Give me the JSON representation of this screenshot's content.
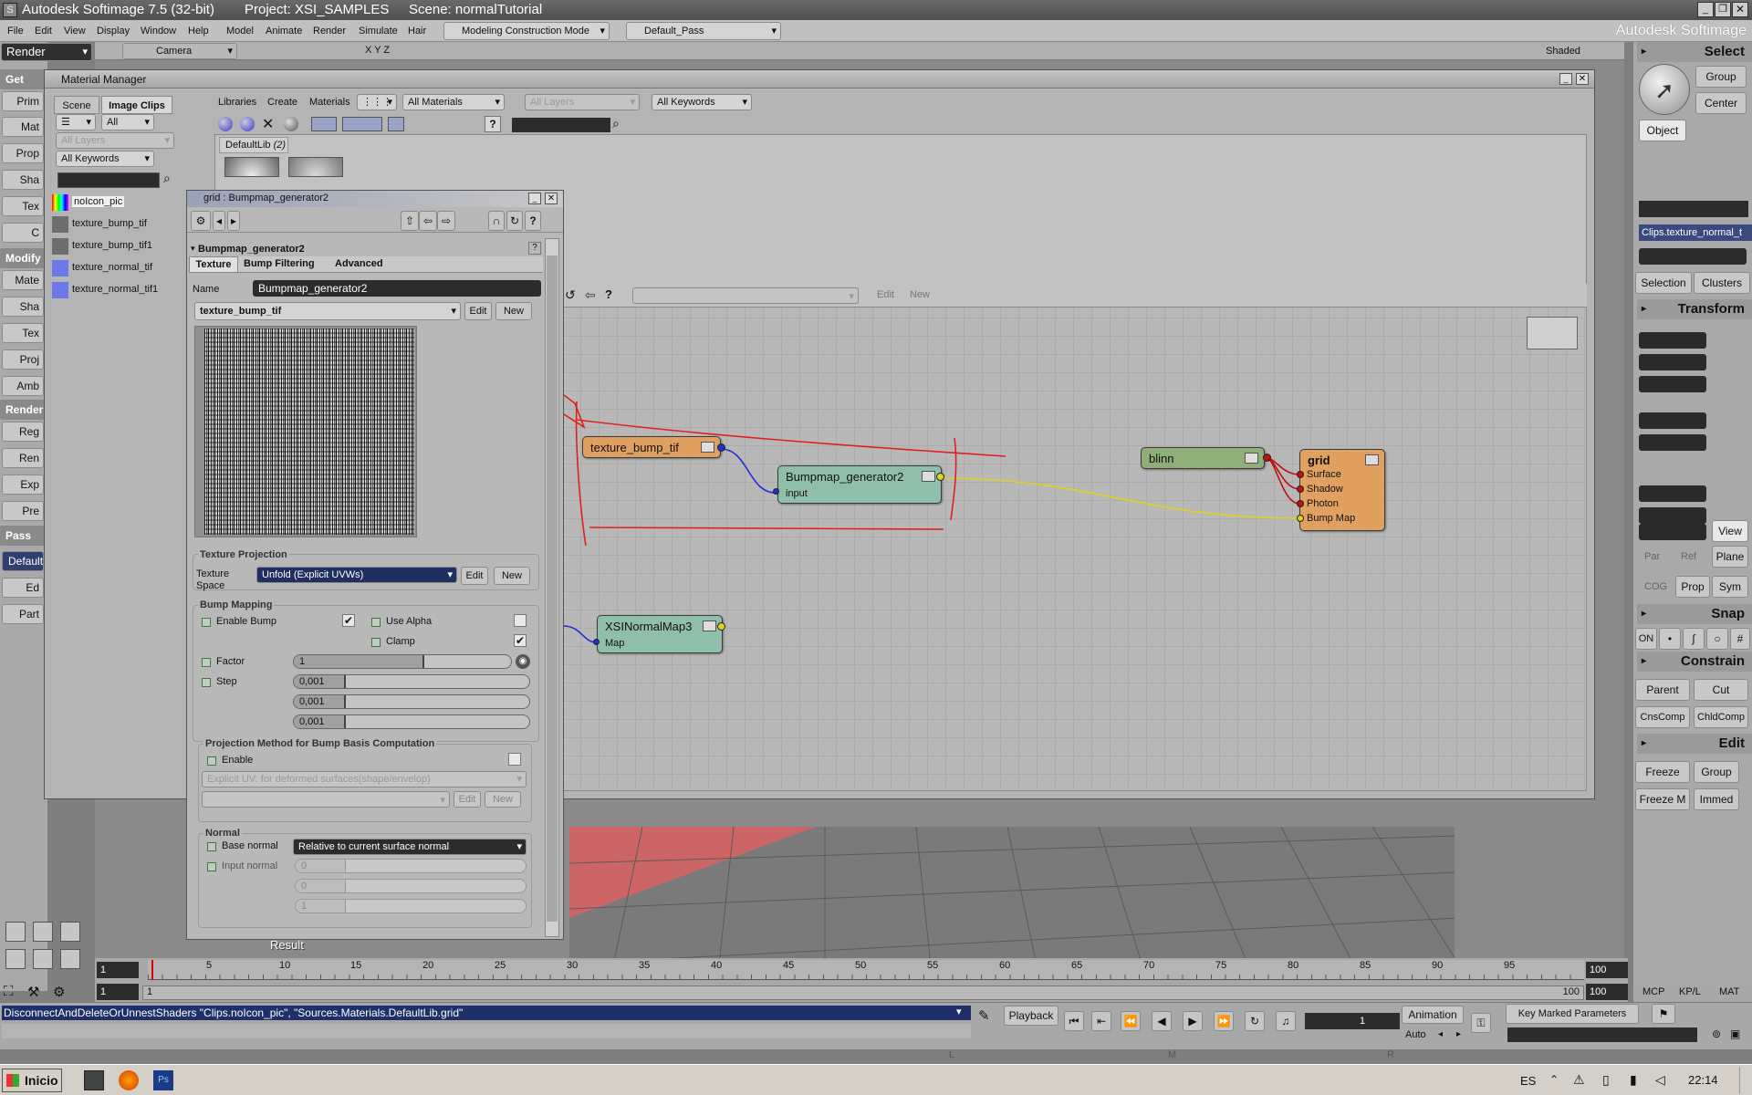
{
  "window": {
    "title": "Autodesk Softimage 7.5 (32-bit)",
    "project": "Project: XSI_SAMPLES",
    "scene": "Scene: normalTutorial",
    "brand": "Autodesk Softimage"
  },
  "menu": [
    "File",
    "Edit",
    "View",
    "Display",
    "Window",
    "Help",
    "Model",
    "Animate",
    "Render",
    "Simulate",
    "Hair"
  ],
  "mode_select": "Modeling Construction Mode",
  "pass_select": "Default_Pass",
  "left": {
    "module": "Render",
    "sections": {
      "get": "Get",
      "modify": "Modify",
      "render": "Render",
      "pass": "Pass"
    },
    "get_items": [
      "Prim",
      "Mat",
      "Prop",
      "Sha",
      "Tex",
      "C"
    ],
    "modify_items": [
      "Mate",
      "Sha",
      "Tex",
      "Proj",
      "Amb"
    ],
    "render_items": [
      "Reg",
      "Ren",
      "Exp",
      "Pre"
    ],
    "pass_items": [
      "Default",
      "Ed",
      "Part"
    ]
  },
  "viewport": {
    "camera": "Camera",
    "axes": "X Y Z",
    "shading": "Shaded",
    "label": "Result"
  },
  "material_manager": {
    "title": "Material Manager",
    "tabs": [
      "Scene",
      "Image Clips"
    ],
    "filter_all": "All",
    "layers": "All Layers",
    "keywords": "All Keywords",
    "clips": [
      "noIcon_pic",
      "texture_bump_tif",
      "texture_bump_tif1",
      "texture_normal_tif",
      "texture_normal_tif1"
    ],
    "toolbar": [
      "Libraries",
      "Create",
      "Materials"
    ],
    "materials_filter": "All Materials",
    "layers_filter": "All Layers",
    "keywords_filter": "All Keywords",
    "library": "DefaultLib",
    "library_count": "(2)",
    "graph_edit": "Edit",
    "graph_new": "New"
  },
  "nodes": {
    "texture": "texture_bump_tif",
    "bump": "Bumpmap_generator2",
    "bump_input": "input",
    "normalmap": "XSINormalMap3",
    "normalmap_port": "Map",
    "blinn": "blinn",
    "grid": "grid",
    "grid_ports": [
      "Surface",
      "Shadow",
      "Photon",
      "Bump Map"
    ]
  },
  "ppg": {
    "title": "grid : Bumpmap_generator2",
    "header": "Bumpmap_generator2",
    "tabs": [
      "Texture",
      "Bump Filtering",
      "Advanced"
    ],
    "name_label": "Name",
    "name_value": "Bumpmap_generator2",
    "texture_select": "texture_bump_tif",
    "edit": "Edit",
    "new": "New",
    "proj_section": "Texture Projection",
    "proj_label1": "Texture",
    "proj_label2": "Space",
    "proj_value": "Unfold (Explicit UVWs)",
    "bump_section": "Bump Mapping",
    "enable_bump": "Enable Bump",
    "use_alpha": "Use Alpha",
    "clamp": "Clamp",
    "factor": "Factor",
    "factor_value": "1",
    "step": "Step",
    "step_values": [
      "0,001",
      "0,001",
      "0,001"
    ],
    "method_section": "Projection Method for Bump Basis Computation",
    "enable": "Enable",
    "method_value": "Explicit UV: for deformed surfaces(shape/envelop)",
    "normal_section": "Normal",
    "base_normal": "Base normal",
    "base_normal_value": "Relative to current surface normal",
    "input_normal": "Input normal",
    "input_values": [
      "0",
      "0",
      "1"
    ]
  },
  "right": {
    "select": "Select",
    "group": "Group",
    "center": "Center",
    "object": "Object",
    "clip_field": "Clips.texture_normal_t",
    "selection": "Selection",
    "clusters": "Clusters",
    "transform": "Transform",
    "view": "View",
    "par": "Par",
    "ref": "Ref",
    "plane": "Plane",
    "cog": "COG",
    "prop": "Prop",
    "sym": "Sym",
    "snap": "Snap",
    "on": "ON",
    "constrain": "Constrain",
    "parent": "Parent",
    "cut": "Cut",
    "cnscomp": "CnsComp",
    "chldcomp": "ChldComp",
    "edit": "Edit",
    "freeze": "Freeze",
    "group2": "Group",
    "freezem": "Freeze M",
    "immed": "Immed",
    "mcp": "MCP",
    "kpl": "KP/L",
    "mat": "MAT"
  },
  "timeline": {
    "start": "1",
    "end": "100",
    "current": "1",
    "current2": "1",
    "range_end": "100",
    "range_end2": "100",
    "ticks": [
      "5",
      "10",
      "15",
      "20",
      "25",
      "30",
      "35",
      "40",
      "45",
      "50",
      "55",
      "60",
      "65",
      "70",
      "75",
      "80",
      "85",
      "90",
      "95"
    ]
  },
  "command": "DisconnectAndDeleteOrUnnestShaders \"Clips.noIcon_pic\", \"Sources.Materials.DefaultLib.grid\"",
  "playback": {
    "playback": "Playback",
    "animation": "Animation",
    "auto": "Auto",
    "frame": "1",
    "key_marked": "Key Marked Parameters",
    "l": "L",
    "m": "M",
    "r": "R"
  },
  "taskbar": {
    "start": "Inicio",
    "lang": "ES",
    "time": "22:14"
  },
  "colors": {
    "menubar": "#c0c0c0",
    "node_orange": "#e0a060",
    "node_teal": "#8fbfaa",
    "node_green": "#8fae7a",
    "annotation": "#e02020"
  }
}
